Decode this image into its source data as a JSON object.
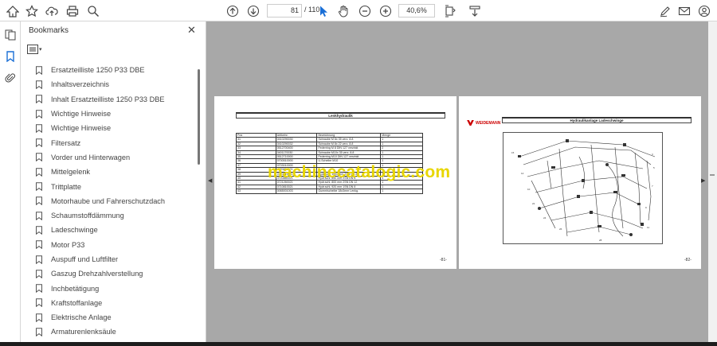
{
  "toolbar": {
    "current_page": "81",
    "page_total": "/ 110",
    "zoom": "40,6%"
  },
  "panel": {
    "title": "Bookmarks"
  },
  "bookmarks": [
    "Ersatzteilliste 1250 P33 DBE",
    "Inhaltsverzeichnis",
    "Inhalt Ersatzteilliste 1250 P33 DBE",
    "Wichtige Hinweise",
    "Wichtige Hinweise",
    "Filtersatz",
    "Vorder und Hinterwagen",
    "Mittelgelenk",
    "Trittplatte",
    "Motorhaube und Fahrerschutzdach",
    "Schaumstoffdämmung",
    "Ladeschwinge",
    "Motor P33",
    "Auspuff und Luftfilter",
    "Gaszug Drehzahlverstellung",
    "Inchbetätigung",
    "Kraftstoffanlage",
    "Elektrische Anlage",
    "Armaturenlenksäule"
  ],
  "left_page": {
    "title": "Lenkhydraulik",
    "headers": [
      "Pos",
      "Artikelnr.",
      "Bezeichnung",
      "Menge"
    ],
    "rows": [
      [
        "31",
        "0410290030",
        "Schraube M 8x 35   verz. 8.8",
        "1"
      ],
      [
        "32",
        "0410290032",
        "Schraube M 8x 22   verz. 8.8",
        "1"
      ],
      [
        "33",
        "0512700400",
        "Federring M 8 DIN 127 verzinkt",
        "2"
      ],
      [
        "34",
        "0401170030",
        "Schraube M10x 35   verz. 8.8",
        "1"
      ],
      [
        "35",
        "0512710000",
        "Federring M10 DIN 127 verzinkt",
        "1"
      ],
      [
        "36",
        "0700510000",
        "U-Scheibe M10",
        "1"
      ],
      [
        "37",
        "0703010000",
        "",
        "1"
      ],
      [
        "38",
        "0720810021",
        "",
        "1"
      ],
      [
        "39",
        "0720810021",
        "Hydr.schl. 1000 mm  2SN  DN  8",
        "1"
      ],
      [
        "40",
        "0720880021",
        "Hydr.schl.  850 mm  2SN  DN  8",
        "1"
      ],
      [
        "41",
        "0721260021",
        "Hydr.schl.  800 mm  2SN  DN 12",
        "1"
      ],
      [
        "42",
        "0710810021",
        "Hydr.schl.  920 mm  1SN  DN  8",
        "1"
      ],
      [
        "43",
        "0065001003",
        "Gummischeibe  18x3mm Lenkg.",
        "1"
      ]
    ],
    "page_number": "-81-"
  },
  "right_page": {
    "title": "Hydraulikanlage Ladeschwinge",
    "logo": "WEIDEMANN",
    "page_number": "-82-"
  },
  "watermark": "machinecatalogic.com",
  "colors": {
    "viewer_bg": "#a8a8a8",
    "accent_blue": "#1a6fd6",
    "watermark": "#e8d600"
  }
}
